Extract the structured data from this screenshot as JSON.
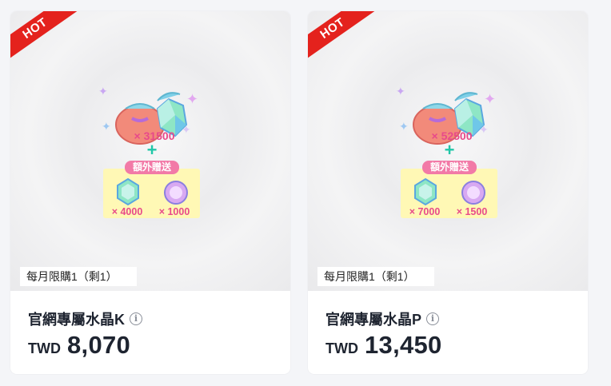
{
  "products": [
    {
      "badge": "HOT",
      "main_quantity": "× 31500",
      "bonus_title": "額外贈送",
      "bonus_items": [
        "× 4000",
        "× 1000"
      ],
      "limit": "每月限購1（剩1）",
      "name": "官網專屬水晶K",
      "currency": "TWD",
      "price": "8,070"
    },
    {
      "badge": "HOT",
      "main_quantity": "× 52500",
      "bonus_title": "額外贈送",
      "bonus_items": [
        "× 7000",
        "× 1500"
      ],
      "limit": "每月限購1（剩1）",
      "name": "官網專屬水晶P",
      "currency": "TWD",
      "price": "13,450"
    }
  ],
  "icons": {
    "info": "info-icon",
    "crystal_bag": "crystal-bag-icon",
    "crystal": "crystal-icon",
    "gem": "round-gem-icon",
    "sparkle": "sparkle-icon"
  },
  "colors": {
    "hot_ribbon": "#e4221d",
    "quantity_text": "#e84a8a",
    "plus": "#21c7a8",
    "bonus_box": "#fff8b5",
    "bonus_title_bg": "#f27aa7",
    "price_text": "#1e2430"
  }
}
